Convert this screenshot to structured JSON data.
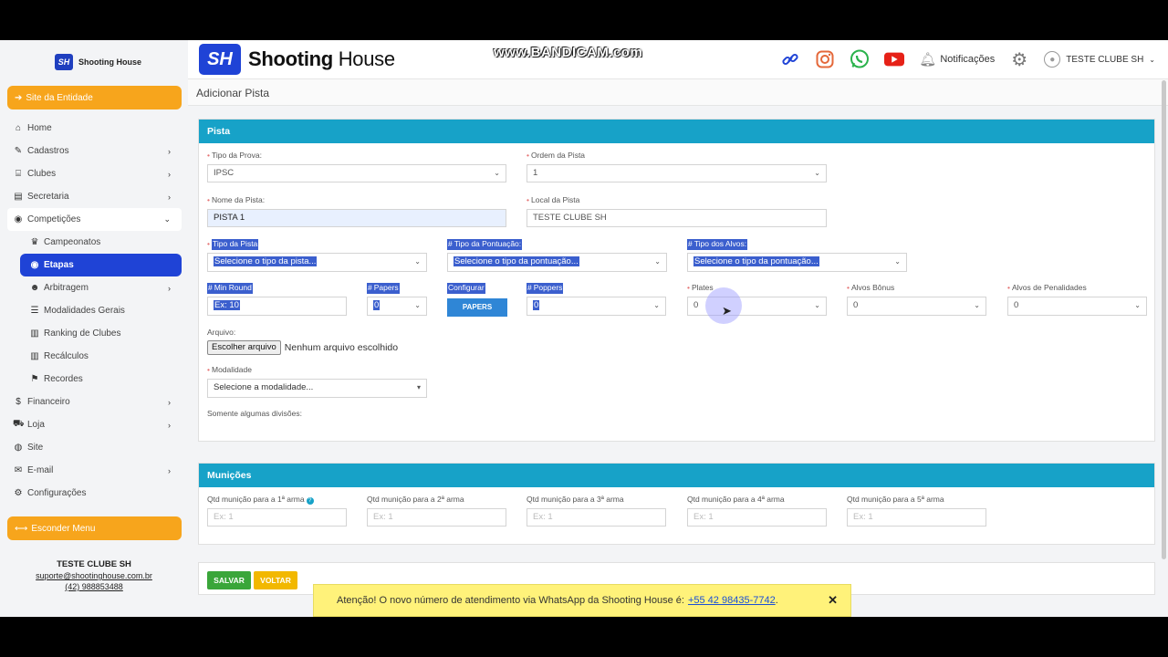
{
  "watermark": "www.BANDICAM.com",
  "colors": {
    "accent": "#1f43d6",
    "section": "#17a2c8",
    "orange": "#f7a51c",
    "save": "#3aa63a",
    "voltar": "#f2b800"
  },
  "sidebar": {
    "logo_mark": "SH",
    "logo_text": "Shooting House",
    "site_button": "Site da Entidade",
    "hide_button": "Esconder Menu",
    "items": [
      {
        "label": "Home",
        "icon": "home-icon",
        "glyph": "⌂",
        "chev": ""
      },
      {
        "label": "Cadastros",
        "icon": "edit-icon",
        "glyph": "✎",
        "chev": "›"
      },
      {
        "label": "Clubes",
        "icon": "bank-icon",
        "glyph": "⌸",
        "chev": "›"
      },
      {
        "label": "Secretaria",
        "icon": "book-icon",
        "glyph": "▤",
        "chev": "›"
      },
      {
        "label": "Competições",
        "icon": "target-icon",
        "glyph": "◉",
        "chev": "⌄"
      },
      {
        "label": "Campeonatos",
        "icon": "trophy-icon",
        "glyph": "♛",
        "chev": ""
      },
      {
        "label": "Etapas",
        "icon": "target-icon",
        "glyph": "◉",
        "chev": ""
      },
      {
        "label": "Arbitragem",
        "icon": "users-icon",
        "glyph": "☻",
        "chev": "›"
      },
      {
        "label": "Modalidades Gerais",
        "icon": "list-icon",
        "glyph": "☰",
        "chev": ""
      },
      {
        "label": "Ranking de Clubes",
        "icon": "chart-icon",
        "glyph": "▥",
        "chev": ""
      },
      {
        "label": "Recálculos",
        "icon": "chart-icon",
        "glyph": "▥",
        "chev": ""
      },
      {
        "label": "Recordes",
        "icon": "flag-icon",
        "glyph": "⚑",
        "chev": ""
      },
      {
        "label": "Financeiro",
        "icon": "dollar-icon",
        "glyph": "$",
        "chev": "›"
      },
      {
        "label": "Loja",
        "icon": "cart-icon",
        "glyph": "⛟",
        "chev": "›"
      },
      {
        "label": "Site",
        "icon": "globe-icon",
        "glyph": "◍",
        "chev": ""
      },
      {
        "label": "E-mail",
        "icon": "mail-icon",
        "glyph": "✉",
        "chev": "›"
      },
      {
        "label": "Configurações",
        "icon": "gears-icon",
        "glyph": "⚙",
        "chev": ""
      }
    ],
    "footer_name": "TESTE CLUBE SH",
    "footer_email": "suporte@shootinghouse.com.br",
    "footer_phone": "(42) 988853488"
  },
  "header": {
    "brand_mark": "SH",
    "brand_bold": "Shooting",
    "brand_light": "House",
    "notifications": "Notificações",
    "user": "TESTE CLUBE SH"
  },
  "page_title": "Adicionar Pista",
  "pista": {
    "title": "Pista",
    "tipo_prova_label": "Tipo da Prova:",
    "tipo_prova_value": "IPSC",
    "ordem_label": "Ordem da Pista",
    "ordem_value": "1",
    "nome_label": "Nome da Pista:",
    "nome_value": "PISTA 1",
    "local_label": "Local da Pista",
    "local_value": "TESTE CLUBE SH",
    "tipo_pista_label": "Tipo da Pista",
    "tipo_pista_value": "Selecione o tipo da pista...",
    "tipo_pont_label": "Tipo da Pontuação:",
    "tipo_pont_value": "Selecione o tipo da pontuação...",
    "tipo_alvos_label": "Tipo dos Alvos:",
    "tipo_alvos_value": "Selecione o tipo da pontuação...",
    "min_round_label": "Min Round",
    "min_round_value": "Ex: 10",
    "papers_label": "Papers",
    "papers_value": "0",
    "configurar_label": "Configurar",
    "configurar_button": "PAPERS",
    "poppers_label": "Poppers",
    "poppers_value": "0",
    "plates_label": "Plates",
    "plates_value": "0",
    "bonus_label": "Alvos Bônus",
    "bonus_value": "0",
    "penal_label": "Alvos de Penalidades",
    "penal_value": "0",
    "arquivo_label": "Arquivo:",
    "arquivo_button": "Escolher arquivo",
    "arquivo_status": "Nenhum arquivo escolhido",
    "modalidade_label": "Modalidade",
    "modalidade_value": "Selecione a modalidade...",
    "divisoes_note": "Somente algumas divisões:"
  },
  "municoes": {
    "title": "Munições",
    "fields": [
      {
        "label": "Qtd munição para a 1ª arma",
        "placeholder": "Ex: 1"
      },
      {
        "label": "Qtd munição para a 2ª arma",
        "placeholder": "Ex: 1"
      },
      {
        "label": "Qtd munição para a 3ª arma",
        "placeholder": "Ex: 1"
      },
      {
        "label": "Qtd munição para a 4ª arma",
        "placeholder": "Ex: 1"
      },
      {
        "label": "Qtd munição para a 5ª arma",
        "placeholder": "Ex: 1"
      }
    ]
  },
  "actions": {
    "save": "SALVAR",
    "back": "VOLTAR"
  },
  "toast": {
    "text": "Atenção! O novo número de atendimento via WhatsApp da Shooting House é:",
    "link": "+55 42 98435-7742",
    "after": ".",
    "close": "✕"
  }
}
